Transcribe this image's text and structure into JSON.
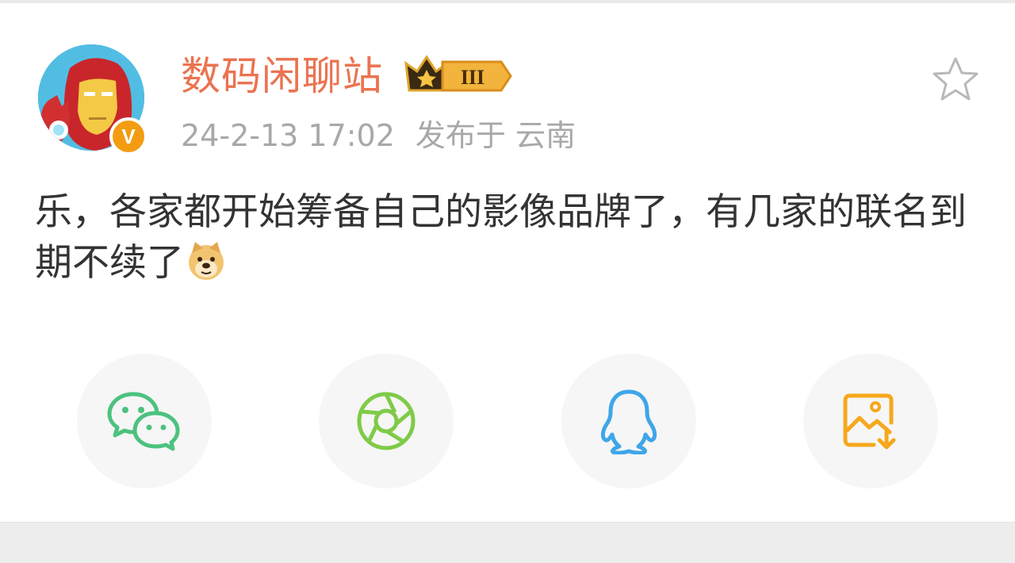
{
  "post": {
    "author": {
      "name": "数码闲聊站",
      "verified_badge": "V",
      "level_badge": "III"
    },
    "time": "24-2-13 17:02",
    "location": "发布于 云南",
    "text": "乐，各家都开始筹备自己的影像品牌了，有几家的联名到期不续了",
    "emoji": "doge-icon"
  },
  "actions": {
    "favorite": "star-icon"
  },
  "share": [
    {
      "name": "wechat",
      "icon": "wechat-icon",
      "color": "#4cc27e"
    },
    {
      "name": "moments",
      "icon": "moments-icon",
      "color": "#7fcb48"
    },
    {
      "name": "qq",
      "icon": "qq-icon",
      "color": "#3fa6e8"
    },
    {
      "name": "save-image",
      "icon": "save-image-icon",
      "color": "#f6a81d"
    }
  ],
  "colors": {
    "username": "#eb7350",
    "meta": "#a8a8a8",
    "text": "#333333",
    "share_bg": "#f6f6f6"
  }
}
